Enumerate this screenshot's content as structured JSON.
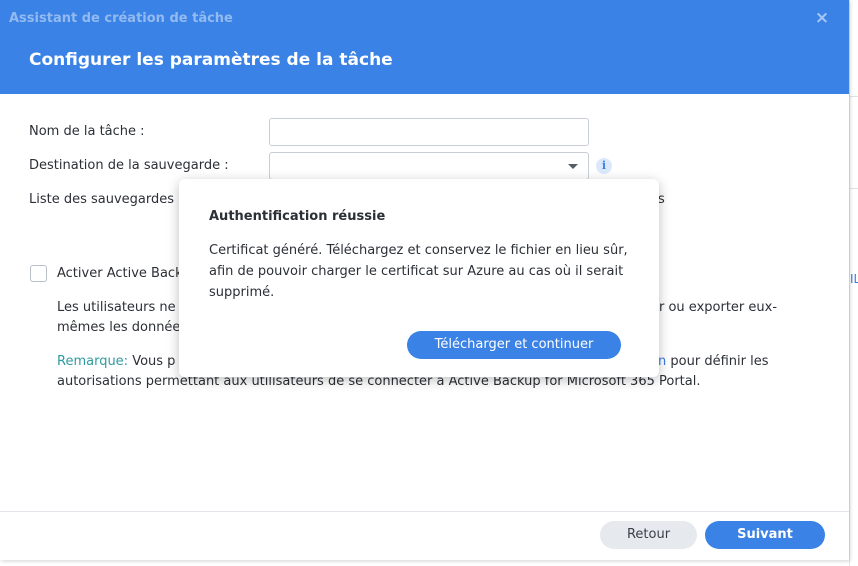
{
  "window": {
    "title": "Assistant de création de tâche",
    "close_icon": "×",
    "step_title": "Configurer les paramètres de la tâche"
  },
  "form": {
    "task_name_label": "Nom de la tâche :",
    "task_name_value": "",
    "destination_label": "Destination de la sauvegarde :",
    "destination_value": "",
    "backup_list_label": "Liste des sauvegardes",
    "backup_list_tail": "s",
    "info_icon": "i"
  },
  "portal": {
    "checkbox_label": "Activer Active Back",
    "checked": false,
    "desc_line1_start": "Les utilisateurs ne",
    "desc_line1_end": "r ou exporter eux-",
    "desc_line2": "mêmes les donnée",
    "note_label": "Remarque:",
    "note_line1_start": "Vous p",
    "note_link": "n",
    "note_line1_end": "pour définir les",
    "note_line2": "autorisations permettant aux utilisateurs de se connecter à Active Backup for Microsoft 365 Portal."
  },
  "footer": {
    "back_label": "Retour",
    "next_label": "Suivant"
  },
  "modal": {
    "title": "Authentification réussie",
    "message": "Certificat généré. Téléchargez et conservez le fichier en lieu sûr, afin de pouvoir charger le certificat sur Azure au cas où il serait supprimé.",
    "button_label": "Télécharger et continuer"
  },
  "background": {
    "edge_fragment": "IL"
  },
  "colors": {
    "accent": "#3a82e6",
    "note": "#2f9aa0",
    "link": "#3a7be3"
  }
}
